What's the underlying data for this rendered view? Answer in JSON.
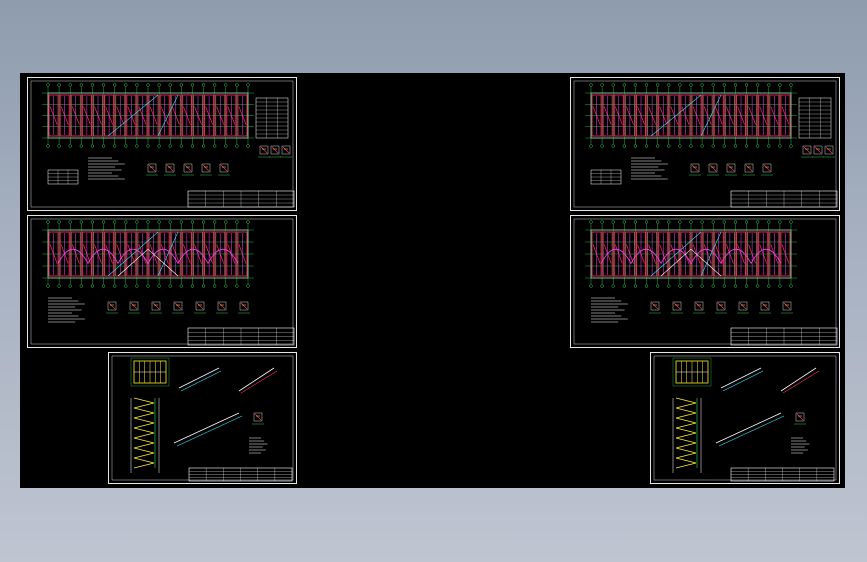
{
  "viewer": {
    "background_top": "#8e9cae",
    "background_bottom": "#bfc5d1",
    "canvas_color": "#000000"
  },
  "drawing_sheets": [
    {
      "id": "left-top",
      "kind": "floor-plan-wide"
    },
    {
      "id": "left-middle",
      "kind": "floor-plan-arched"
    },
    {
      "id": "left-bottom",
      "kind": "stair-detail"
    },
    {
      "id": "right-top",
      "kind": "floor-plan-wide"
    },
    {
      "id": "right-middle",
      "kind": "floor-plan-arched"
    },
    {
      "id": "right-bottom",
      "kind": "stair-detail"
    }
  ],
  "colors": {
    "frame": "#e6e6e6",
    "wall_red": "#ff2a6a",
    "dim_green": "#3cff6a",
    "cyan": "#35e6ff",
    "magenta": "#ff40ff",
    "yellow": "#ffee33",
    "white": "#ffffff"
  }
}
